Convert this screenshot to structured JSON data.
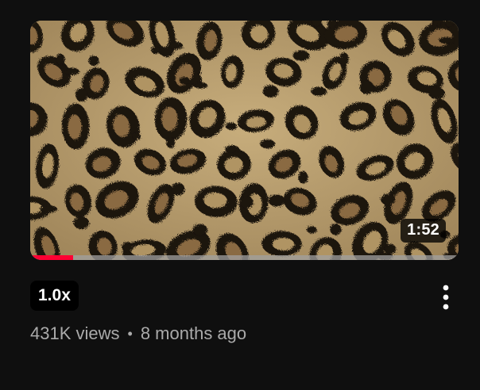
{
  "video": {
    "duration": "1:52",
    "progress_percent": 10,
    "speed": "1.0x",
    "views": "431K views",
    "separator": "•",
    "age": "8 months ago"
  },
  "icons": {
    "more": "vertical-ellipsis-icon"
  },
  "colors": {
    "background": "#0f0f0f",
    "progress": "#ff0033",
    "meta_text": "#aaaaaa"
  }
}
